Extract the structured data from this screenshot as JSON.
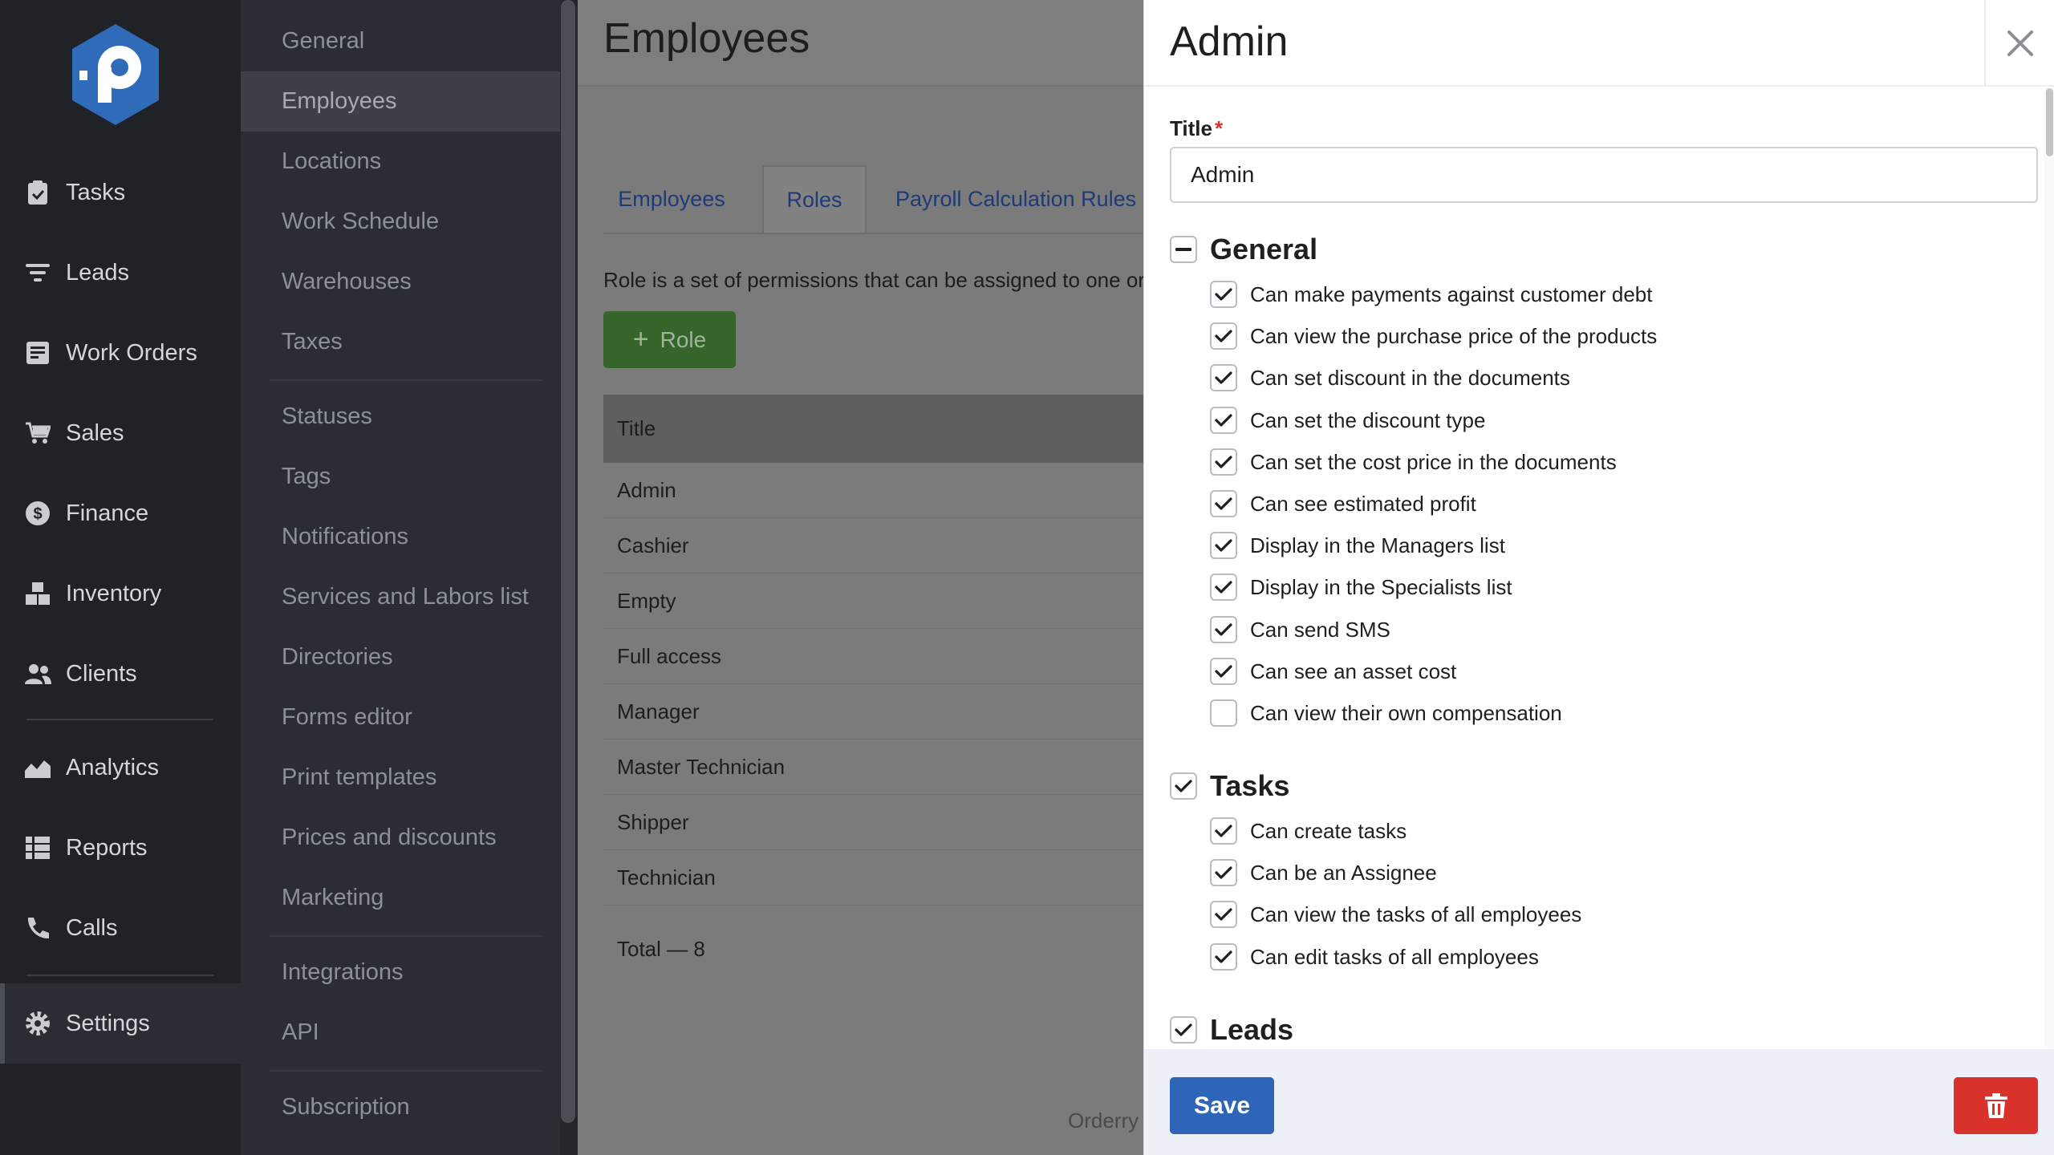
{
  "nav": {
    "items": [
      {
        "label": "Tasks",
        "icon": "clipboard-check-icon"
      },
      {
        "label": "Leads",
        "icon": "filter-lines-icon"
      },
      {
        "label": "Work Orders",
        "icon": "document-box-icon"
      },
      {
        "label": "Sales",
        "icon": "cart-icon"
      },
      {
        "label": "Finance",
        "icon": "dollar-circle-icon"
      },
      {
        "label": "Inventory",
        "icon": "boxes-icon"
      },
      {
        "label": "Clients",
        "icon": "users-icon"
      },
      {
        "label": "Analytics",
        "icon": "area-chart-icon"
      },
      {
        "label": "Reports",
        "icon": "list-grid-icon"
      },
      {
        "label": "Calls",
        "icon": "phone-icon"
      },
      {
        "label": "Settings",
        "icon": "gear-icon"
      }
    ]
  },
  "submenu": {
    "items": [
      {
        "label": "General"
      },
      {
        "label": "Employees"
      },
      {
        "label": "Locations"
      },
      {
        "label": "Work Schedule"
      },
      {
        "label": "Warehouses"
      },
      {
        "label": "Taxes"
      },
      {
        "label": "Statuses"
      },
      {
        "label": "Tags"
      },
      {
        "label": "Notifications"
      },
      {
        "label": "Services and Labors list"
      },
      {
        "label": "Directories"
      },
      {
        "label": "Forms editor"
      },
      {
        "label": "Print templates"
      },
      {
        "label": "Prices and discounts"
      },
      {
        "label": "Marketing"
      },
      {
        "label": "Integrations"
      },
      {
        "label": "API"
      },
      {
        "label": "Subscription"
      }
    ]
  },
  "main": {
    "title": "Employees",
    "tabs": [
      {
        "label": "Employees"
      },
      {
        "label": "Roles"
      },
      {
        "label": "Payroll Calculation Rules"
      }
    ],
    "description": "Role is a set of permissions that can be assigned to one or",
    "add_role_label": "Role",
    "table_header": "Title",
    "roles": [
      "Admin",
      "Cashier",
      "Empty",
      "Full access",
      "Manager",
      "Master Technician",
      "Shipper",
      "Technician"
    ],
    "total": "Total — 8",
    "footer_text": "Orderry"
  },
  "panel": {
    "title": "Admin",
    "field_label": "Title",
    "title_value": "Admin",
    "sections": [
      {
        "name": "General",
        "state": "partial",
        "permissions": [
          {
            "label": "Can make payments against customer debt",
            "checked": true
          },
          {
            "label": "Can view the purchase price of the products",
            "checked": true
          },
          {
            "label": "Can set discount in the documents",
            "checked": true
          },
          {
            "label": "Can set the discount type",
            "checked": true
          },
          {
            "label": "Can set the cost price in the documents",
            "checked": true
          },
          {
            "label": "Can see estimated profit",
            "checked": true
          },
          {
            "label": "Display in the Managers list",
            "checked": true
          },
          {
            "label": "Display in the Specialists list",
            "checked": true
          },
          {
            "label": "Can send SMS",
            "checked": true
          },
          {
            "label": "Can see an asset cost",
            "checked": true
          },
          {
            "label": "Can view their own compensation",
            "checked": false
          }
        ]
      },
      {
        "name": "Tasks",
        "state": "checked",
        "permissions": [
          {
            "label": "Can create tasks",
            "checked": true
          },
          {
            "label": "Can be an Assignee",
            "checked": true
          },
          {
            "label": "Can view the tasks of all employees",
            "checked": true
          },
          {
            "label": "Can edit tasks of all employees",
            "checked": true
          }
        ]
      },
      {
        "name": "Leads",
        "state": "checked",
        "permissions": []
      }
    ],
    "save_label": "Save"
  },
  "colors": {
    "accent": "#2f65b8",
    "danger": "#d8322b",
    "success": "#36642b",
    "nav_bg": "#1f2227",
    "logo": "#2f6bb8"
  }
}
